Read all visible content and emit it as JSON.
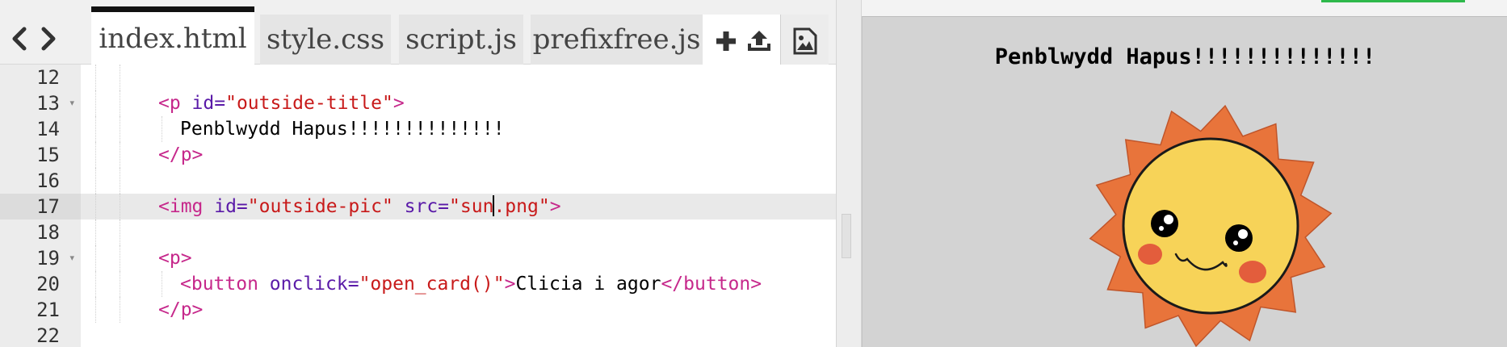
{
  "editor": {
    "tabs": [
      {
        "label": "index.html",
        "active": true
      },
      {
        "label": "style.css",
        "active": false
      },
      {
        "label": "script.js",
        "active": false
      },
      {
        "label": "prefixfree.js",
        "active": false
      }
    ],
    "icons": {
      "back": "chevron-left-icon",
      "forward": "chevron-right-icon",
      "add_file": "plus-icon",
      "upload": "upload-icon",
      "image_assets": "image-icon"
    },
    "lines": [
      {
        "n": "12"
      },
      {
        "n": "13",
        "fold": "▾",
        "p1": "<p",
        "p2": " id=",
        "p3": "\"outside-title\"",
        "p4": ">"
      },
      {
        "n": "14",
        "text": "Penblwydd Hapus!!!!!!!!!!!!!!"
      },
      {
        "n": "15",
        "p1": "</p>"
      },
      {
        "n": "16"
      },
      {
        "n": "17",
        "p1": "<img",
        "p2": " id=",
        "p3": "\"outside-pic\"",
        "p4": " src=",
        "p5": "\"sun",
        "p6": ".png\"",
        "p7": ">"
      },
      {
        "n": "18"
      },
      {
        "n": "19",
        "fold": "▾",
        "p1": "<p>"
      },
      {
        "n": "20",
        "p1": "<button",
        "p2": " onclick=",
        "p3": "\"open_card()\"",
        "p4": ">",
        "p5": "Clicia i agor",
        "p6": "</button>",
        "p7": ">"
      },
      {
        "n": "21",
        "p1": "</p>"
      },
      {
        "n": "22"
      }
    ]
  },
  "preview": {
    "title": "Penblwydd Hapus!!!!!!!!!!!!!!",
    "image": "sun-illustration"
  },
  "colors": {
    "tag": "#c6288b",
    "attribute": "#5a1aa8",
    "string": "#c81a1a",
    "preview_bg": "#d3d3d3",
    "sun_face": "#f7d358",
    "sun_rays": "#e8743b",
    "cheeks": "#e0503a",
    "accent_green": "#2eb84b"
  }
}
